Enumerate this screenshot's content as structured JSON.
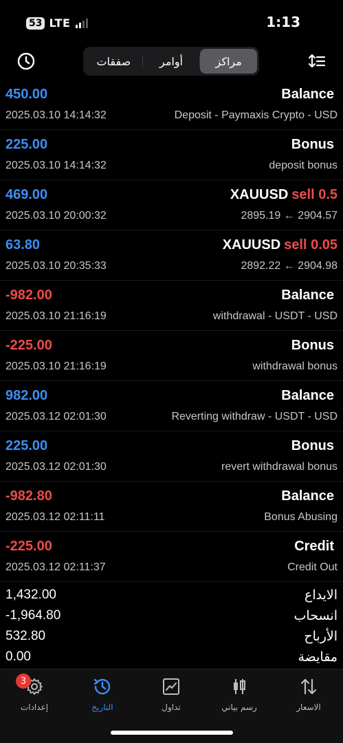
{
  "status_bar": {
    "battery": "53",
    "network": "LTE",
    "time": "1:13"
  },
  "tabs": [
    {
      "label": "مراكز",
      "active": true
    },
    {
      "label": "أوامر",
      "active": false
    },
    {
      "label": "صفقات",
      "active": false
    }
  ],
  "rows": [
    {
      "amount": "450.00",
      "sign": "pos",
      "date": "2025.03.10 14:14:32",
      "title": "Balance",
      "sell": "",
      "desc": "Deposit - Paymaxis Crypto - USD"
    },
    {
      "amount": "225.00",
      "sign": "pos",
      "date": "2025.03.10 14:14:32",
      "title": "Bonus",
      "sell": "",
      "desc": "deposit bonus"
    },
    {
      "amount": "469.00",
      "sign": "pos",
      "date": "2025.03.10 20:00:32",
      "title": "XAUUSD",
      "sell": "sell 0.5",
      "desc": "2895.19 ← 2904.57"
    },
    {
      "amount": "63.80",
      "sign": "pos",
      "date": "2025.03.10 20:35:33",
      "title": "XAUUSD",
      "sell": "sell 0.05",
      "desc": "2892.22 ← 2904.98"
    },
    {
      "amount": "-982.00",
      "sign": "neg",
      "date": "2025.03.10 21:16:19",
      "title": "Balance",
      "sell": "",
      "desc": "withdrawal - USDT - USD"
    },
    {
      "amount": "-225.00",
      "sign": "neg",
      "date": "2025.03.10 21:16:19",
      "title": "Bonus",
      "sell": "",
      "desc": "withdrawal bonus"
    },
    {
      "amount": "982.00",
      "sign": "pos",
      "date": "2025.03.12 02:01:30",
      "title": "Balance",
      "sell": "",
      "desc": "Reverting withdraw - USDT - USD"
    },
    {
      "amount": "225.00",
      "sign": "pos",
      "date": "2025.03.12 02:01:30",
      "title": "Bonus",
      "sell": "",
      "desc": "revert withdrawal bonus"
    },
    {
      "amount": "-982.80",
      "sign": "neg",
      "date": "2025.03.12 02:11:11",
      "title": "Balance",
      "sell": "",
      "desc": "Bonus Abusing"
    },
    {
      "amount": "-225.00",
      "sign": "neg",
      "date": "2025.03.12 02:11:37",
      "title": "Credit",
      "sell": "",
      "desc": "Credit Out"
    }
  ],
  "summary": [
    {
      "label": "الايداع",
      "value": "1,432.00"
    },
    {
      "label": "انسحاب",
      "value": "-1,964.80"
    },
    {
      "label": "الأرباح",
      "value": "532.80"
    },
    {
      "label": "مقايضة",
      "value": "0.00"
    }
  ],
  "nav": [
    {
      "label": "إعدادات",
      "icon": "gear-icon",
      "badge": "3",
      "active": false
    },
    {
      "label": "التاريخ",
      "icon": "history-icon",
      "badge": "",
      "active": true
    },
    {
      "label": "تداول",
      "icon": "trade-chart-icon",
      "badge": "",
      "active": false
    },
    {
      "label": "رسم بياني",
      "icon": "candlestick-icon",
      "badge": "",
      "active": false
    },
    {
      "label": "الاسعار",
      "icon": "quotes-arrows-icon",
      "badge": "",
      "active": false
    }
  ],
  "colors": {
    "positive": "#3d8ef5",
    "negative": "#ef4b4b",
    "background": "#000000"
  }
}
